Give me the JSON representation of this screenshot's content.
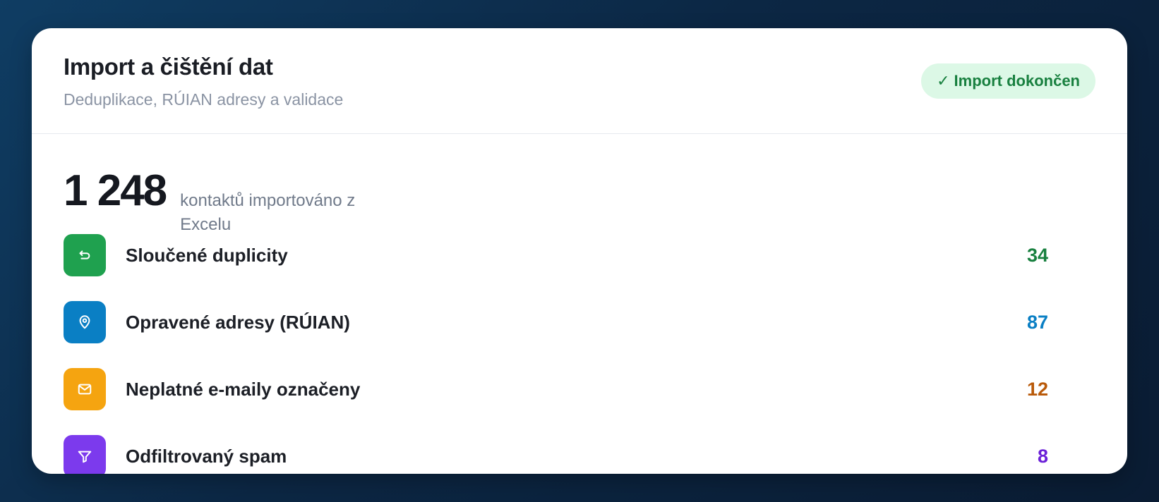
{
  "header": {
    "title": "Import a čištění dat",
    "subtitle": "Deduplikace, RÚIAN adresy a validace",
    "badge_icon": "✓",
    "badge_label": "Import dokončen"
  },
  "summary": {
    "count": "1 248",
    "description": "kontaktů importováno z Excelu"
  },
  "rows": [
    {
      "label": "Sloučené duplicity",
      "value": "34",
      "icon": "merge-return-icon",
      "color": "#1fa14f",
      "value_color": "#18803f"
    },
    {
      "label": "Opravené adresy (RÚIAN)",
      "value": "87",
      "icon": "map-pin-icon",
      "color": "#0a7fc4",
      "value_color": "#0a7fc4"
    },
    {
      "label": "Neplatné e-maily označeny",
      "value": "12",
      "icon": "mail-icon",
      "color": "#f5a410",
      "value_color": "#b95a0a"
    },
    {
      "label": "Odfiltrovaný spam",
      "value": "8",
      "icon": "filter-icon",
      "color": "#7c3aed",
      "value_color": "#6b21d8"
    }
  ]
}
